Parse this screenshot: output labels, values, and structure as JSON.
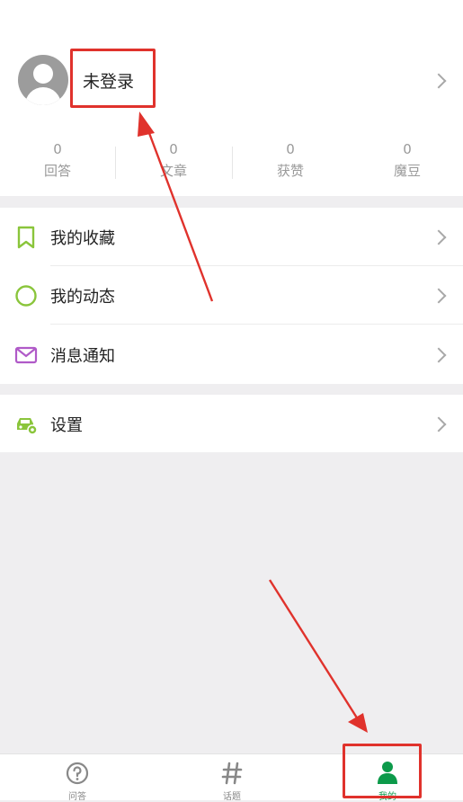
{
  "profile": {
    "login_label": "未登录"
  },
  "stats": [
    {
      "value": "0",
      "label": "回答"
    },
    {
      "value": "0",
      "label": "文章"
    },
    {
      "value": "0",
      "label": "获赞"
    },
    {
      "value": "0",
      "label": "魔豆"
    }
  ],
  "menu": {
    "favorites": "我的收藏",
    "activity": "我的动态",
    "notifications": "消息通知",
    "settings": "设置"
  },
  "tabs": {
    "qa": "问答",
    "topics": "话题",
    "mine": "我的"
  },
  "colors": {
    "accent_green": "#8ac53b",
    "tab_active": "#0c9a4a",
    "message_purple": "#b05ac8",
    "annotation_red": "#e0322c"
  },
  "icons": {
    "avatar": "avatar-icon",
    "favorites": "bookmark-icon",
    "activity": "circle-icon",
    "notifications": "envelope-icon",
    "settings": "car-gear-icon",
    "qa": "question-icon",
    "topics": "hashtag-icon",
    "mine": "person-icon"
  }
}
